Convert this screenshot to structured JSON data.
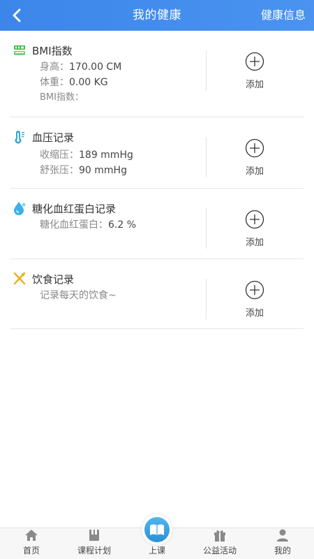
{
  "header": {
    "title": "我的健康",
    "action_label": "健康信息"
  },
  "records": [
    {
      "title": "BMI指数",
      "icon": "bmi-scale-icon",
      "lines": [
        {
          "label": "身高：",
          "value": "170.00 CM"
        },
        {
          "label": "体重：",
          "value": "0.00 KG"
        },
        {
          "label": "BMI指数：",
          "value": ""
        }
      ],
      "add_label": "添加"
    },
    {
      "title": "血压记录",
      "icon": "thermometer-icon",
      "lines": [
        {
          "label": "收缩压：",
          "value": "189 mmHg"
        },
        {
          "label": "舒张压：",
          "value": "90 mmHg"
        }
      ],
      "add_label": "添加"
    },
    {
      "title": "糖化血红蛋白记录",
      "icon": "blood-drop-icon",
      "lines": [
        {
          "label": "糖化血红蛋白：",
          "value": "6.2 %"
        }
      ],
      "add_label": "添加"
    },
    {
      "title": "饮食记录",
      "icon": "fork-spoon-icon",
      "lines": [
        {
          "label": "记录每天的饮食~",
          "value": ""
        }
      ],
      "add_label": "添加"
    }
  ],
  "nav": [
    {
      "label": "首页",
      "icon": "home-icon"
    },
    {
      "label": "课程计划",
      "icon": "book-schedule-icon"
    },
    {
      "label": "上课",
      "icon": "open-book-icon"
    },
    {
      "label": "公益活动",
      "icon": "gift-icon"
    },
    {
      "label": "我的",
      "icon": "user-icon"
    }
  ],
  "colors": {
    "header_start": "#3c86ea",
    "header_end": "#4a93f0",
    "bmi_icon": "#3dbb47",
    "thermometer": "#2ba8d6",
    "drop": "#3bb2e8",
    "utensils": "#e8b21c",
    "center_button": "#2a8fd8"
  }
}
